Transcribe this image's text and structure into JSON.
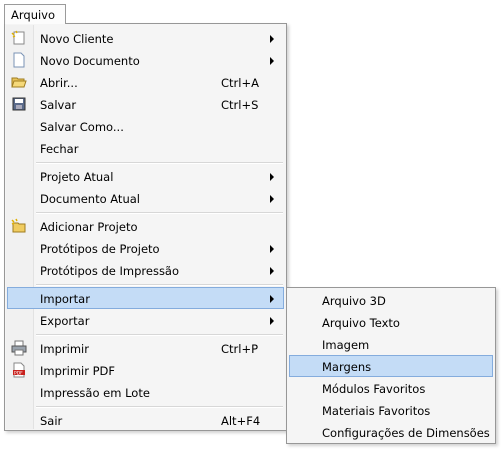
{
  "menubar": {
    "arquivo": "Arquivo"
  },
  "menu": {
    "novo_cliente": "Novo Cliente",
    "novo_documento": "Novo Documento",
    "abrir": "Abrir...",
    "abrir_sc": "Ctrl+A",
    "salvar": "Salvar",
    "salvar_sc": "Ctrl+S",
    "salvar_como": "Salvar Como...",
    "fechar": "Fechar",
    "projeto_atual": "Projeto Atual",
    "documento_atual": "Documento Atual",
    "adicionar_projeto": "Adicionar Projeto",
    "prototipos_projeto": "Protótipos de Projeto",
    "prototipos_impressao": "Protótipos de Impressão",
    "importar": "Importar",
    "exportar": "Exportar",
    "imprimir": "Imprimir",
    "imprimir_sc": "Ctrl+P",
    "imprimir_pdf": "Imprimir PDF",
    "impressao_lote": "Impressão em Lote",
    "sair": "Sair",
    "sair_sc": "Alt+F4"
  },
  "submenu": {
    "arquivo_3d": "Arquivo 3D",
    "arquivo_texto": "Arquivo Texto",
    "imagem": "Imagem",
    "margens": "Margens",
    "modulos_favoritos": "Módulos Favoritos",
    "materiais_favoritos": "Materiais Favoritos",
    "config_dimensoes": "Configurações de Dimensões"
  },
  "icons": {
    "novo_cliente": "new-client-icon",
    "novo_documento": "new-document-icon",
    "abrir": "open-folder-icon",
    "salvar": "save-disk-icon",
    "adicionar_projeto": "add-project-icon",
    "imprimir": "printer-icon",
    "imprimir_pdf": "pdf-icon"
  },
  "colors": {
    "highlight": "#c4dcf6",
    "highlight_border": "#84acdd"
  }
}
